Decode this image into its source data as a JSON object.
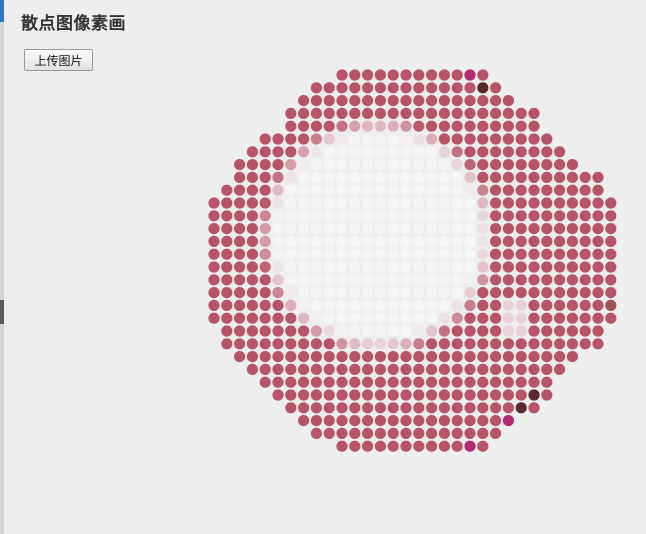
{
  "page": {
    "title": "散点图像素画",
    "upload_button_label": "上传图片"
  },
  "dot_art": {
    "colors": {
      "dominant": "#b85468",
      "highlight": "#f5f4f6",
      "edge_pink": "#d4a2b0",
      "accent_magenta": "#b42a72",
      "accent_red": "#ff2f30",
      "accent_black": "#2a2a2a",
      "accent_brown": "#5a2a2a",
      "accent_darkred": "#8f2a2a"
    }
  }
}
